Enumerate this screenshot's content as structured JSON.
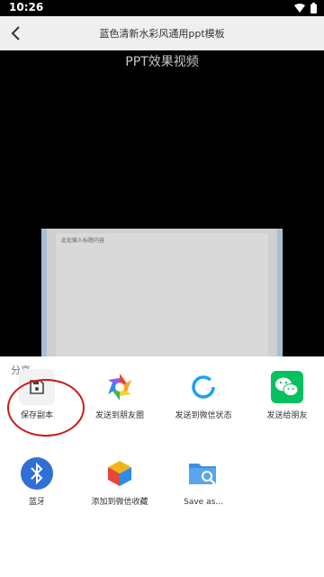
{
  "status": {
    "time": "10:26"
  },
  "app_bar": {
    "title": "蓝色清新水彩风通用ppt模板"
  },
  "video": {
    "title": "PPT效果视频",
    "slide_text": "此处输入标题内容"
  },
  "share_sheet": {
    "title": "分享",
    "items": [
      {
        "label": "保存副本",
        "icon": "save-icon"
      },
      {
        "label": "发送到朋友圈",
        "icon": "moments-icon"
      },
      {
        "label": "发送到微信状态",
        "icon": "wechat-status-icon"
      },
      {
        "label": "发送给朋友",
        "icon": "wechat-icon"
      },
      {
        "label": "蓝牙",
        "icon": "bluetooth-icon"
      },
      {
        "label": "添加到微信收藏",
        "icon": "favorites-cube-icon"
      },
      {
        "label": "Save as...",
        "icon": "save-as-folder-icon"
      }
    ]
  },
  "colors": {
    "wechat_green": "#07c160",
    "bluetooth_blue": "#2f6fd6",
    "highlight_red": "#cc1a1a"
  }
}
